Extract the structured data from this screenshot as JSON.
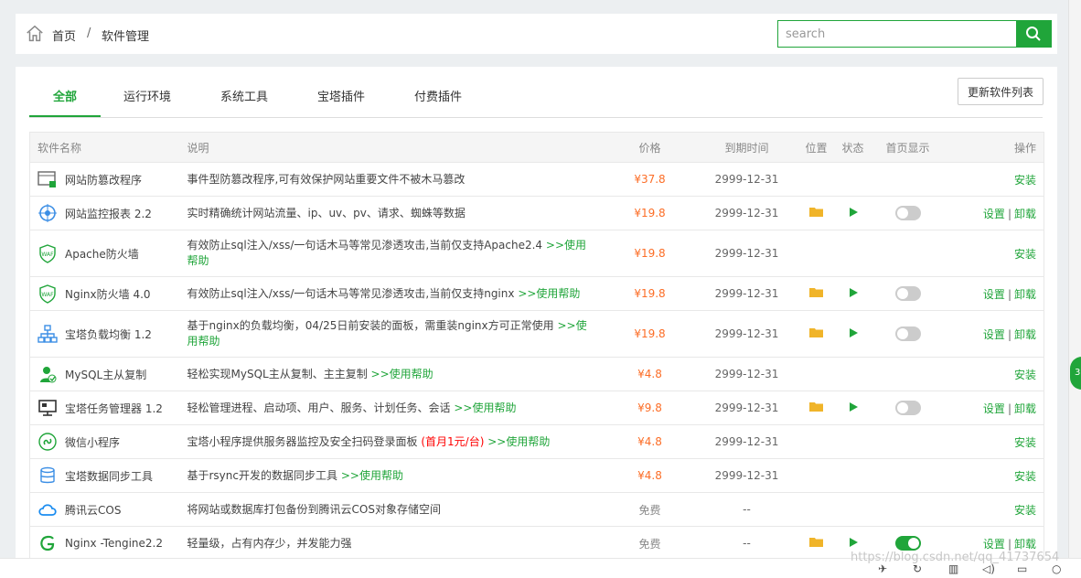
{
  "breadcrumb": {
    "home": "首页",
    "separator": "/",
    "current": "软件管理"
  },
  "search": {
    "placeholder": "search"
  },
  "tabs": [
    {
      "label": "全部",
      "active": true
    },
    {
      "label": "运行环境"
    },
    {
      "label": "系统工具"
    },
    {
      "label": "宝塔插件"
    },
    {
      "label": "付费插件"
    }
  ],
  "update_button": "更新软件列表",
  "columns": {
    "name": "软件名称",
    "desc": "说明",
    "price": "价格",
    "expire": "到期时间",
    "location": "位置",
    "status": "状态",
    "homepage": "首页显示",
    "ops": "操作"
  },
  "actions": {
    "install": "安装",
    "settings": "设置",
    "uninstall": "卸载",
    "sep": "|"
  },
  "rows": [
    {
      "name": "网站防篡改程序",
      "icon": "tamper-icon",
      "desc": "事件型防篡改程序,可有效保护网站重要文件不被木马篡改",
      "price": "¥37.8",
      "expire": "2999-12-31",
      "installed": false
    },
    {
      "name": "网站监控报表 2.2",
      "icon": "monitor-icon",
      "desc": "实时精确统计网站流量、ip、uv、pv、请求、蜘蛛等数据",
      "price": "¥19.8",
      "expire": "2999-12-31",
      "installed": true,
      "homepage_on": false
    },
    {
      "name": "Apache防火墙",
      "icon": "waf-icon",
      "desc": "有效防止sql注入/xss/一句话木马等常见渗透攻击,当前仅支持Apache2.4",
      "help": ">>使用帮助",
      "price": "¥19.8",
      "expire": "2999-12-31",
      "installed": false,
      "tall": true
    },
    {
      "name": "Nginx防火墙 4.0",
      "icon": "waf-icon",
      "desc": "有效防止sql注入/xss/一句话木马等常见渗透攻击,当前仅支持nginx",
      "help": ">>使用帮助",
      "price": "¥19.8",
      "expire": "2999-12-31",
      "installed": true,
      "homepage_on": false
    },
    {
      "name": "宝塔负载均衡 1.2",
      "icon": "loadbalance-icon",
      "desc": "基于nginx的负载均衡，04/25日前安装的面板，需重装nginx方可正常使用",
      "help": ">>使用帮助",
      "price": "¥19.8",
      "expire": "2999-12-31",
      "installed": true,
      "homepage_on": false,
      "tall": true
    },
    {
      "name": "MySQL主从复制",
      "icon": "mysql-replication-icon",
      "desc": "轻松实现MySQL主从复制、主主复制",
      "help": ">>使用帮助",
      "price": "¥4.8",
      "expire": "2999-12-31",
      "installed": false
    },
    {
      "name": "宝塔任务管理器 1.2",
      "icon": "task-manager-icon",
      "desc": "轻松管理进程、启动项、用户、服务、计划任务、会话",
      "help": ">>使用帮助",
      "price": "¥9.8",
      "expire": "2999-12-31",
      "installed": true,
      "homepage_on": false
    },
    {
      "name": "微信小程序",
      "icon": "wechat-miniapp-icon",
      "desc": "宝塔小程序提供服务器监控及安全扫码登录面板",
      "promo": "(首月1元/台)",
      "help": ">>使用帮助",
      "price": "¥4.8",
      "expire": "2999-12-31",
      "installed": false
    },
    {
      "name": "宝塔数据同步工具",
      "icon": "database-sync-icon",
      "desc": "基于rsync开发的数据同步工具",
      "help": ">>使用帮助",
      "price": "¥4.8",
      "expire": "2999-12-31",
      "installed": false
    },
    {
      "name": "腾讯云COS",
      "icon": "cloud-icon",
      "desc": "将网站或数据库打包备份到腾讯云COS对象存储空间",
      "price": "免费",
      "free": true,
      "expire": "--",
      "installed": false
    },
    {
      "name": "Nginx -Tengine2.2",
      "icon": "tengine-icon",
      "desc": "轻量级，占有内存少，并发能力强",
      "price": "免费",
      "free": true,
      "expire": "--",
      "installed": true,
      "homepage_on": true
    }
  ],
  "watermark": "https://blog.csdn.net/qq_41737654",
  "float_badge": "3",
  "colors": {
    "accent": "#20a53a",
    "price": "#fc6d26",
    "promo": "#ff0000",
    "folder": "#f0b429"
  }
}
